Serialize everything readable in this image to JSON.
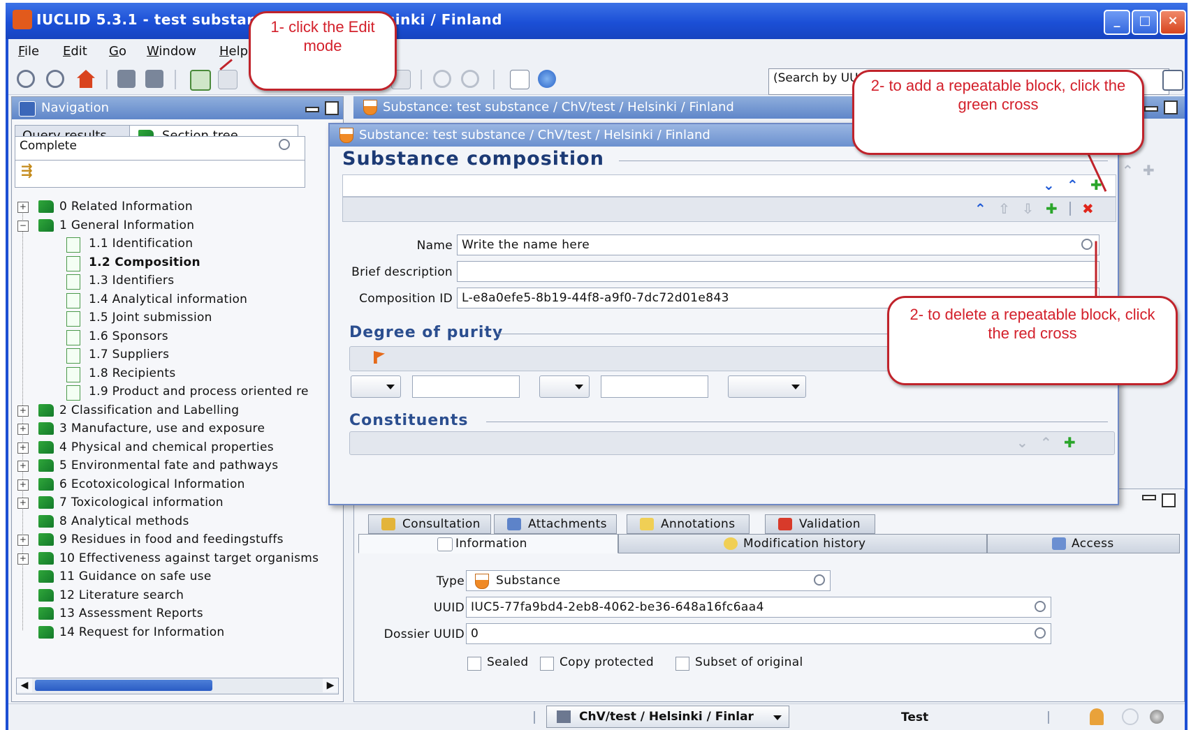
{
  "window": {
    "title": "IUCLID 5.3.1 - test substance / ChV/test / Helsinki / Finland",
    "title_visible": "IUCLID 5.3.1 - test substanc",
    "title_tail": "lsinki / Finland"
  },
  "menu": [
    {
      "label": "File",
      "underline": "F",
      "rest": "ile"
    },
    {
      "label": "Edit",
      "underline": "E",
      "rest": "dit"
    },
    {
      "label": "Go",
      "underline": "G",
      "rest": "o"
    },
    {
      "label": "Window",
      "underline": "W",
      "rest": "indow"
    },
    {
      "label": "Help",
      "underline": "H",
      "rest": "elp"
    }
  ],
  "toolbar": {
    "search_placeholder": "(Search by UU"
  },
  "navigation": {
    "title": "Navigation",
    "tabs": [
      "Query results",
      "Section tree"
    ],
    "filter_value": "Complete",
    "tree": [
      {
        "label": "0 Related Information",
        "level": 0,
        "expander": "+"
      },
      {
        "label": "1 General Information",
        "level": 0,
        "expander": "-"
      },
      {
        "label": "1.1 Identification",
        "level": 1
      },
      {
        "label": "1.2 Composition",
        "level": 1,
        "bold": true
      },
      {
        "label": "1.3 Identifiers",
        "level": 1
      },
      {
        "label": "1.4 Analytical information",
        "level": 1
      },
      {
        "label": "1.5 Joint submission",
        "level": 1
      },
      {
        "label": "1.6 Sponsors",
        "level": 1
      },
      {
        "label": "1.7 Suppliers",
        "level": 1
      },
      {
        "label": "1.8 Recipients",
        "level": 1
      },
      {
        "label": "1.9 Product and process oriented re",
        "level": 1
      },
      {
        "label": "2 Classification and Labelling",
        "level": 0,
        "expander": "+"
      },
      {
        "label": "3 Manufacture, use and exposure",
        "level": 0,
        "expander": "+"
      },
      {
        "label": "4 Physical and chemical properties",
        "level": 0,
        "expander": "+"
      },
      {
        "label": "5 Environmental fate and pathways",
        "level": 0,
        "expander": "+"
      },
      {
        "label": "6 Ecotoxicological Information",
        "level": 0,
        "expander": "+"
      },
      {
        "label": "7 Toxicological information",
        "level": 0,
        "expander": "+"
      },
      {
        "label": "8 Analytical methods",
        "level": 0
      },
      {
        "label": "9 Residues in food and feedingstuffs",
        "level": 0,
        "expander": "+"
      },
      {
        "label": "10 Effectiveness against target organisms",
        "level": 0,
        "expander": "+"
      },
      {
        "label": "11 Guidance on safe use",
        "level": 0
      },
      {
        "label": "12 Literature search",
        "level": 0
      },
      {
        "label": "13 Assessment Reports",
        "level": 0
      },
      {
        "label": "14 Request for Information",
        "level": 0
      }
    ]
  },
  "main": {
    "header": "Substance: test substance / ChV/test / Helsinki / Finland",
    "composition_window": {
      "title": "Substance: test substance / ChV/test / Helsinki / Finland",
      "section_title": "Substance composition",
      "fields": {
        "name_label": "Name",
        "name_value": "Write the name here",
        "brief_label": "Brief description",
        "brief_value": "",
        "comp_id_label": "Composition ID",
        "comp_id_value": "L-e8a0efe5-8b19-44f8-a9f0-7dc72d01e843"
      },
      "purity_title": "Degree of purity",
      "constituents_title": "Constituents"
    },
    "info_tabs_row1": [
      "Consultation",
      "Attachments",
      "Annotations",
      "Validation"
    ],
    "info_tabs_row2": [
      "Information",
      "Modification history",
      "Access"
    ],
    "info": {
      "type_label": "Type",
      "type_value": "Substance",
      "uuid_label": "UUID",
      "uuid_value": "IUC5-77fa9bd4-2eb8-4062-be36-648a16fc6aa4",
      "dossier_label": "Dossier UUID",
      "dossier_value": "0",
      "checkboxes": [
        "Sealed",
        "Copy protected",
        "Subset of original"
      ]
    }
  },
  "status": {
    "location": "ChV/test / Helsinki / Finlar",
    "mode": "Test"
  },
  "callouts": {
    "edit": "1- click the Edit mode",
    "add": "2- to add a repeatable block, click the green cross",
    "delete": "2- to delete a repeatable block, click the red cross"
  },
  "colors": {
    "title_blue": "#1b4fd6",
    "callout_red": "#c0232b",
    "add_green": "#2aa52a",
    "delete_red": "#e0261b"
  }
}
